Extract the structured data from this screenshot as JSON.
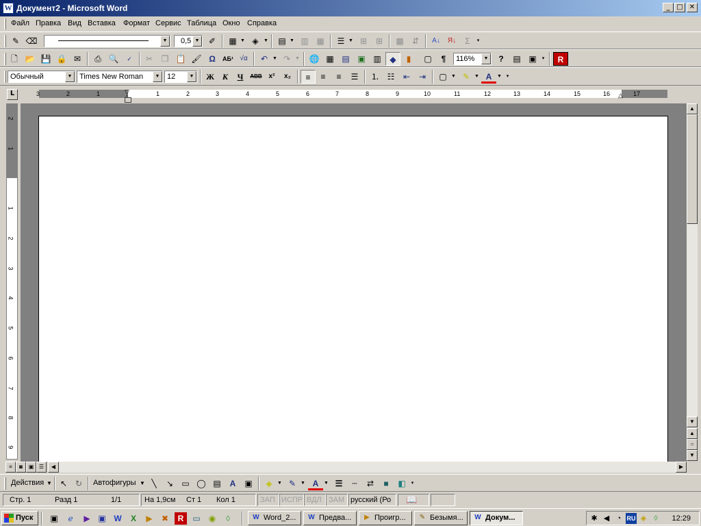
{
  "window": {
    "title": "Документ2 - Microsoft Word",
    "app_icon": "W",
    "controls": {
      "minimize": "_",
      "maximize": "□",
      "close": "✕"
    }
  },
  "menu": [
    "Файл",
    "Правка",
    "Вид",
    "Вставка",
    "Формат",
    "Сервис",
    "Таблица",
    "Окно",
    "Справка"
  ],
  "toolbar_tables": {
    "line_weight": "0,5",
    "icons": [
      "pencil-icon",
      "eraser-icon",
      "line-style-combo",
      "line-weight-combo",
      "border-color-icon",
      "borders-icon",
      "fill-color-icon",
      "insert-table-icon",
      "merge-cells-icon",
      "split-cells-icon",
      "align-icon",
      "distribute-rows-icon",
      "distribute-columns-icon",
      "autoformat-icon",
      "text-direction-icon",
      "sort-ascending-icon",
      "sort-descending-icon",
      "autosum-icon"
    ]
  },
  "toolbar_standard": {
    "zoom": "116%",
    "icons": [
      "new-icon",
      "open-icon",
      "save-icon",
      "permission-icon",
      "email-icon",
      "print-icon",
      "print-preview-icon",
      "spelling-icon",
      "cut-icon",
      "copy-icon",
      "paste-icon",
      "format-painter-icon",
      "symbol-icon",
      "superscript-text-icon",
      "equation-icon",
      "undo-icon",
      "redo-icon",
      "hyperlink-icon",
      "tables-borders-icon",
      "insert-table-icon",
      "insert-excel-icon",
      "columns-icon",
      "drawing-icon",
      "chart-icon",
      "document-map-icon",
      "show-formatting-icon",
      "zoom-combo",
      "help-icon",
      "read-icon",
      "frame-icon",
      "r-addin-icon"
    ],
    "pilcrow": "¶",
    "omega": "Ω"
  },
  "toolbar_formatting": {
    "style": "Обычный",
    "font": "Times New Roman",
    "size": "12",
    "bold": "Ж",
    "italic": "К",
    "underline": "Ч",
    "strikethrough": "АВВ",
    "superscript": "x²",
    "subscript": "x₂"
  },
  "ruler": {
    "left_numbers": [
      "3",
      "2",
      "1"
    ],
    "right_numbers": [
      "1",
      "2",
      "3",
      "4",
      "5",
      "6",
      "7",
      "8",
      "9",
      "10",
      "11",
      "12",
      "13",
      "14",
      "15",
      "16",
      "17"
    ],
    "vertical_numbers": [
      "2",
      "1",
      "1",
      "2",
      "3",
      "4",
      "5",
      "6",
      "7",
      "8",
      "9"
    ],
    "tab_button": "L"
  },
  "drawing_toolbar": {
    "actions": "Действия",
    "autoshapes": "Автофигуры"
  },
  "status": {
    "page": "Стр.  1",
    "section": "Разд  1",
    "pages": "1/1",
    "at": "На  1,9см",
    "line": "Ст  1",
    "col": "Кол  1",
    "rec": "ЗАП",
    "trk": "ИСПР",
    "ext": "ВДЛ",
    "ovr": "ЗАМ",
    "language": "русский (Ро"
  },
  "taskbar": {
    "start": "Пуск",
    "buttons": [
      {
        "label": "Word_2...",
        "icon": "W"
      },
      {
        "label": "Предва...",
        "icon": "W"
      },
      {
        "label": "Проигр...",
        "icon": "▶"
      },
      {
        "label": "Безымя...",
        "icon": "✎"
      },
      {
        "label": "Докум...",
        "icon": "W"
      }
    ],
    "language": "RU",
    "clock": "12:29"
  }
}
